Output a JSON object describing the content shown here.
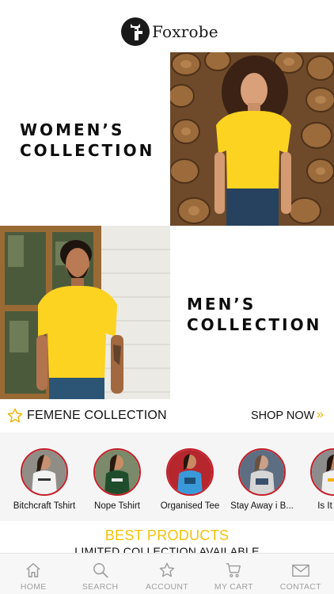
{
  "app": {
    "name": "Foxrobe"
  },
  "collections": {
    "women": {
      "line1": "WOMEN’S",
      "line2": "COLLECTION"
    },
    "men": {
      "line1": "MEN’S",
      "line2": "COLLECTION"
    }
  },
  "section": {
    "title": "FEMENE COLLECTION",
    "shop_now": "SHOP NOW",
    "arrow": "»"
  },
  "products": [
    {
      "name": "Bitchcraft Tshirt",
      "shirt_color": "#f2f2f2"
    },
    {
      "name": "Nope Tshirt",
      "shirt_color": "#1f4d2c"
    },
    {
      "name": "Organised Tee",
      "shirt_color": "#3a9ad9"
    },
    {
      "name": "Stay Away i B...",
      "shirt_color": "#d6d6d6"
    },
    {
      "name": "Is It Frid",
      "shirt_color": "#efefef"
    }
  ],
  "best": {
    "title": "BEST PRODUCTS",
    "subtitle": "LIMITED COLLECTION AVAILABLE"
  },
  "tabs": [
    {
      "label": "HOME",
      "icon": "home-icon"
    },
    {
      "label": "SEARCH",
      "icon": "search-icon"
    },
    {
      "label": "ACCOUNT",
      "icon": "star-icon"
    },
    {
      "label": "MY CART",
      "icon": "cart-icon"
    },
    {
      "label": "CONTACT",
      "icon": "mail-icon"
    }
  ],
  "colors": {
    "accent": "#f5c20a",
    "arrow": "#f0b400",
    "shirt_yellow": "#fbd320"
  }
}
